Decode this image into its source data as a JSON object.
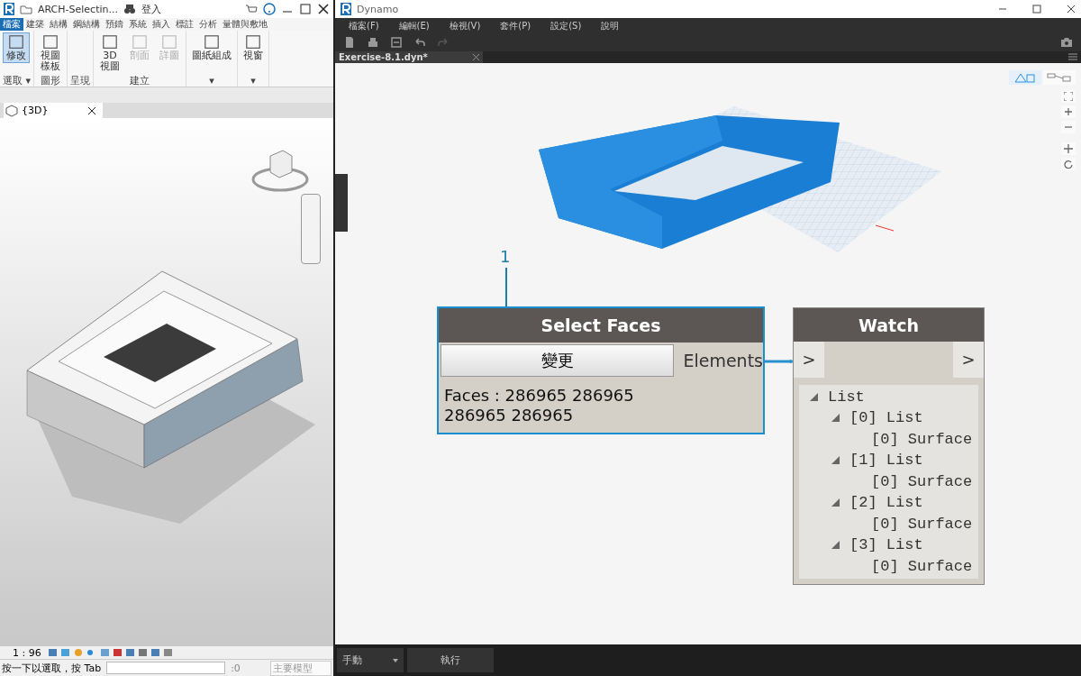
{
  "revit": {
    "title": "ARCH-Selectin...",
    "user": "登入",
    "ribbon_tabs": [
      {
        "label": "檔案",
        "selected": true
      },
      {
        "label": "建築",
        "selected": false
      },
      {
        "label": "結構",
        "selected": false
      },
      {
        "label": "鋼結構",
        "selected": false
      },
      {
        "label": "預鑄",
        "selected": false
      },
      {
        "label": "系統",
        "selected": false
      },
      {
        "label": "插入",
        "selected": false
      },
      {
        "label": "標註",
        "selected": false
      },
      {
        "label": "分析",
        "selected": false
      },
      {
        "label": "量體與敷地",
        "selected": false
      }
    ],
    "panels": [
      {
        "label": "選取 ▾",
        "buttons": [
          {
            "label": "修改",
            "kind": "stacked",
            "selected": true,
            "disabled": false
          }
        ]
      },
      {
        "label": "圖形",
        "buttons": [
          {
            "label": "視圖樣板",
            "kind": "stacked",
            "selected": false,
            "disabled": false
          }
        ]
      },
      {
        "label": "呈現"
      },
      {
        "label": "建立",
        "buttons": [
          {
            "label": "3D 視圖",
            "kind": "stacked",
            "selected": false,
            "disabled": false
          },
          {
            "label": "剖面",
            "kind": "stacked",
            "selected": false,
            "disabled": true
          },
          {
            "label": "詳圖",
            "kind": "stacked",
            "selected": false,
            "disabled": true
          }
        ]
      },
      {
        "label": "▾",
        "buttons": [
          {
            "label": "圖紙組成",
            "kind": "wide",
            "selected": false,
            "disabled": false
          }
        ]
      },
      {
        "label": "▾",
        "buttons": [
          {
            "label": "視窗",
            "kind": "wide",
            "selected": false,
            "disabled": false
          }
        ]
      }
    ],
    "view_tab": "{3D}",
    "scale": "1 : 96",
    "status_text": "按一下以選取，按 Tab",
    "selection_count": ":0",
    "model": "主要模型"
  },
  "dynamo": {
    "title": "Dynamo",
    "menu": [
      "檔案(F)",
      "編輯(E)",
      "檢視(V)",
      "套件(P)",
      "設定(S)",
      "說明"
    ],
    "file_tab": "Exercise-8.1.dyn*",
    "callout": "1",
    "select_node": {
      "title": "Select Faces",
      "button": "變更",
      "port": "Elements",
      "output": "Faces : 286965 286965 286965 286965"
    },
    "watch_node": {
      "title": "Watch",
      "in_port": ">",
      "out_port": ">",
      "tree": [
        {
          "label": "List",
          "expanded": true,
          "children": [
            {
              "label": "[0] List",
              "expanded": true,
              "children": [
                {
                  "label": "[0] Surface"
                }
              ]
            },
            {
              "label": "[1] List",
              "expanded": true,
              "children": [
                {
                  "label": "[0] Surface"
                }
              ]
            },
            {
              "label": "[2] List",
              "expanded": true,
              "children": [
                {
                  "label": "[0] Surface"
                }
              ]
            },
            {
              "label": "[3] List",
              "expanded": true,
              "children": [
                {
                  "label": "[0] Surface"
                }
              ]
            }
          ]
        }
      ]
    },
    "view_modes": [
      {
        "kind": "geometry",
        "selected": true
      },
      {
        "kind": "graph",
        "selected": false
      }
    ],
    "run_mode": "手動",
    "run_button": "執行"
  }
}
